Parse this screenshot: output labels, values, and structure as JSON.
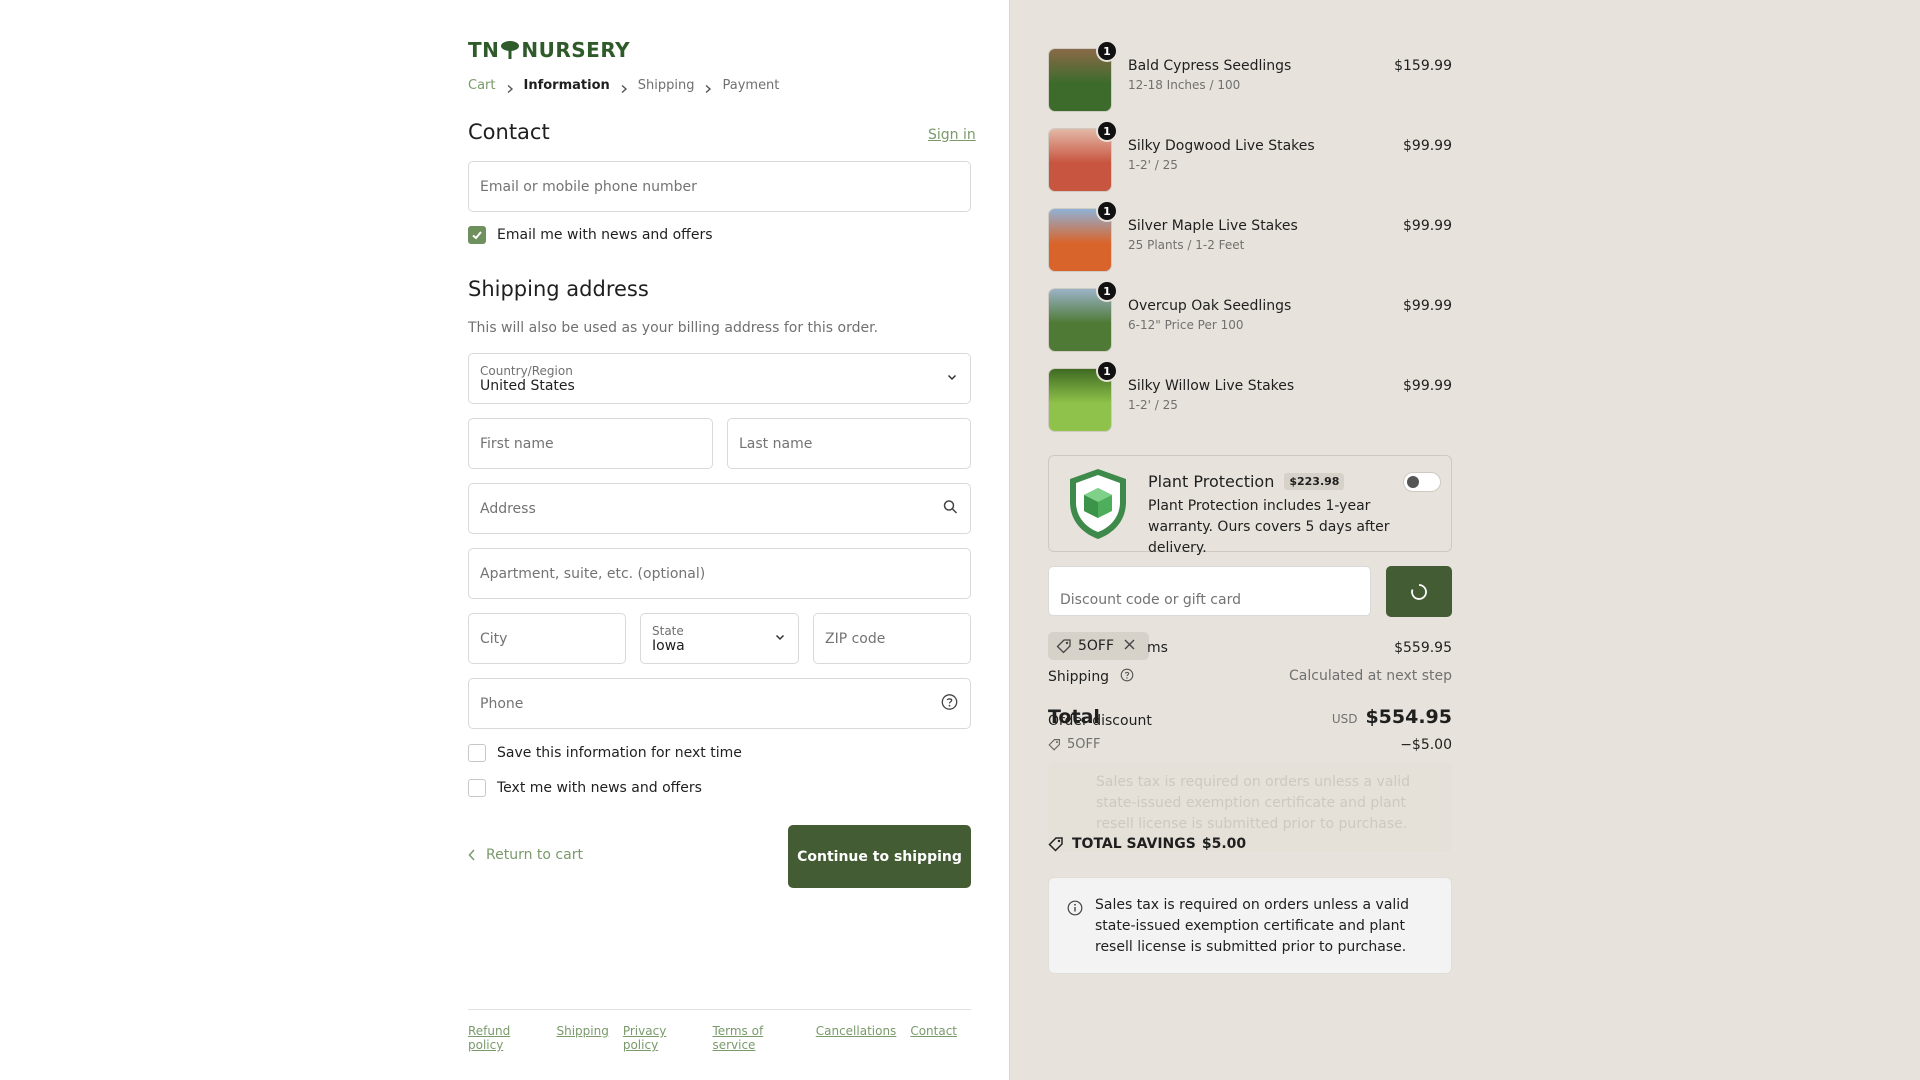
{
  "brand": {
    "logo_text_left": "TN",
    "logo_text_right": "NURSERY"
  },
  "breadcrumb": {
    "cart": "Cart",
    "information": "Information",
    "shipping": "Shipping",
    "payment": "Payment"
  },
  "contact": {
    "title": "Contact",
    "sign_in": "Sign in",
    "email_placeholder": "Email or mobile phone number",
    "email_offers_label": "Email me with news and offers",
    "email_offers_checked": true
  },
  "shipping_address": {
    "title": "Shipping address",
    "subtitle": "This will also be used as your billing address for this order.",
    "country_label": "Country/Region",
    "country_value": "United States",
    "first_name_placeholder": "First name",
    "last_name_placeholder": "Last name",
    "address_placeholder": "Address",
    "apartment_placeholder": "Apartment, suite, etc. (optional)",
    "city_placeholder": "City",
    "state_label": "State",
    "state_value": "Iowa",
    "zip_placeholder": "ZIP code",
    "phone_placeholder": "Phone",
    "save_info_label": "Save this information for next time",
    "text_offers_label": "Text me with news and offers"
  },
  "actions": {
    "return_label": "Return to cart",
    "continue_label": "Continue to shipping"
  },
  "footer_links": [
    "Refund policy",
    "Shipping",
    "Privacy policy",
    "Terms of service",
    "Cancellations",
    "Contact"
  ],
  "order_items": [
    {
      "name": "Bald Cypress Seedlings",
      "variant": "12-18 Inches / 100",
      "price": "$159.99",
      "qty": "1",
      "thumb_colors": [
        "#3d6b2c",
        "#8a6a48"
      ]
    },
    {
      "name": "Silky Dogwood Live Stakes",
      "variant": "1-2' / 25",
      "price": "$99.99",
      "qty": "1",
      "thumb_colors": [
        "#c8553f",
        "#e3b8a8"
      ]
    },
    {
      "name": "Silver Maple Live Stakes",
      "variant": "25 Plants / 1-2 Feet",
      "price": "$99.99",
      "qty": "1",
      "thumb_colors": [
        "#d9642b",
        "#8fb2d6"
      ]
    },
    {
      "name": "Overcup Oak Seedlings",
      "variant": "6-12\" Price Per 100",
      "price": "$99.99",
      "qty": "1",
      "thumb_colors": [
        "#4f7a36",
        "#9bb3c8"
      ]
    },
    {
      "name": "Silky Willow Live Stakes",
      "variant": "1-2' / 25",
      "price": "$99.99",
      "qty": "1",
      "thumb_colors": [
        "#8fc24a",
        "#3f6b22"
      ]
    }
  ],
  "plant_protection": {
    "title": "Plant Protection",
    "price_badge": "$223.98",
    "description": "Plant Protection includes 1-year warranty. Ours covers 5 days after delivery.",
    "enabled": false
  },
  "discount": {
    "placeholder": "Discount code or gift card",
    "applied_code": "5OFF"
  },
  "summary": {
    "subtotal_label": "ms",
    "subtotal_value": "$559.95",
    "shipping_label": "Shipping",
    "shipping_value": "Calculated at next step",
    "total_label": "Total",
    "currency": "USD",
    "total_value": "$554.95",
    "order_discount_label": "Order discount",
    "order_discount_code": "5OFF",
    "order_discount_value": "−$5.00",
    "ghost_notice": "Sales tax is required on orders unless a valid state-issued exemption certificate and plant resell license is submitted prior to purchase.",
    "savings_label": "TOTAL SAVINGS",
    "savings_value": "$5.00"
  },
  "notice": {
    "text": "Sales tax is required on orders unless a valid state-issued exemption certificate and plant resell license is submitted prior to purchase."
  },
  "colors": {
    "brand_green": "#445c33",
    "link_green": "#7a9a6b",
    "right_bg": "#e7e3dc"
  }
}
